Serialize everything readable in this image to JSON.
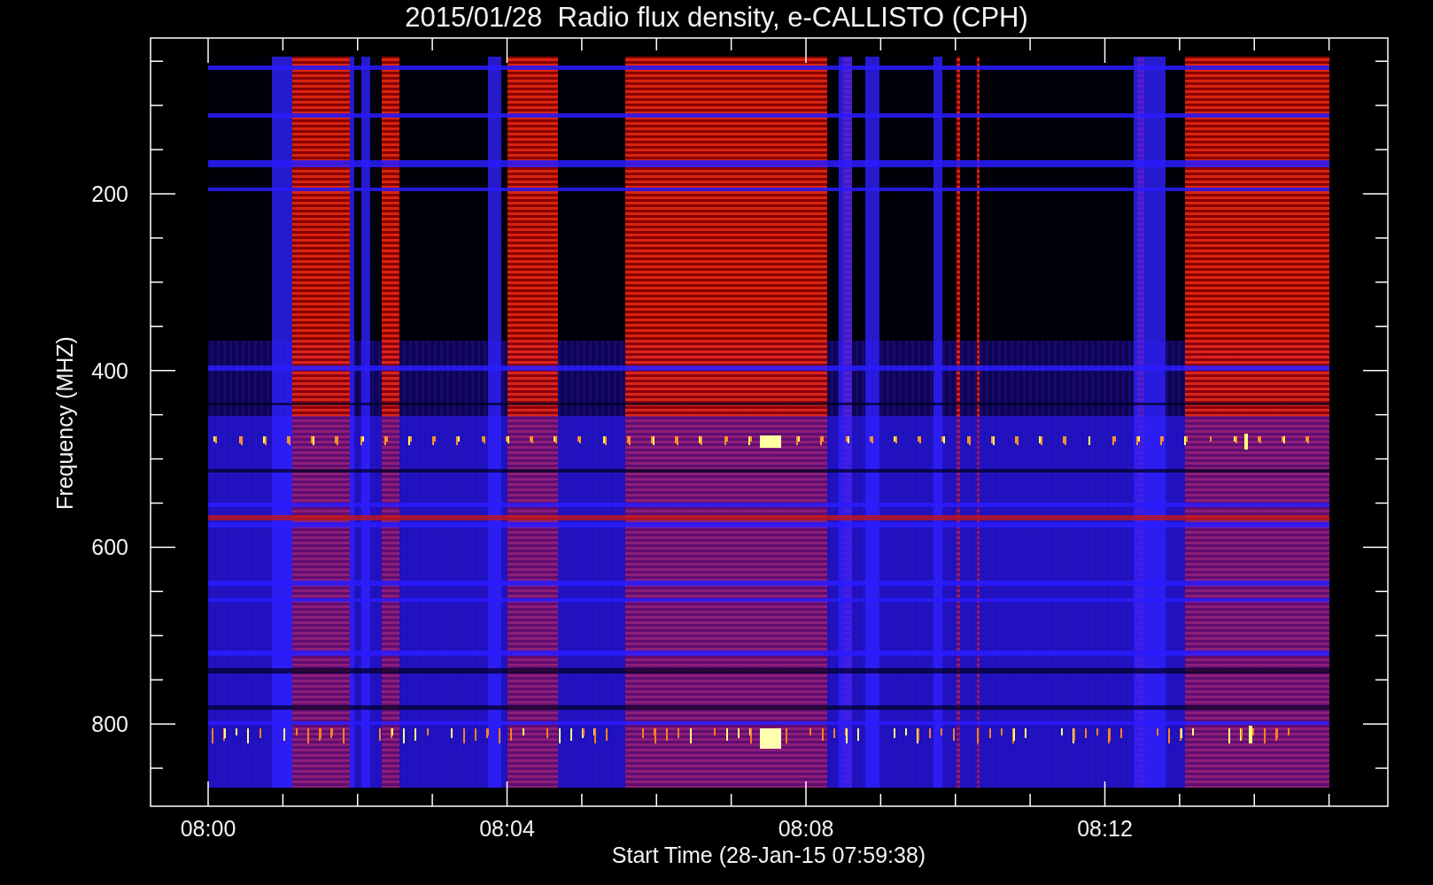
{
  "plot": {
    "title": "2015/01/28  Radio flux density, e-CALLISTO (CPH)",
    "xlabel": "Start Time (28-Jan-15 07:59:38)",
    "ylabel": "Frequency (MHZ)",
    "xtick_labels": [
      "08:00",
      "08:04",
      "08:08",
      "08:12"
    ],
    "ytick_labels": [
      "200",
      "400",
      "600",
      "800"
    ]
  }
}
